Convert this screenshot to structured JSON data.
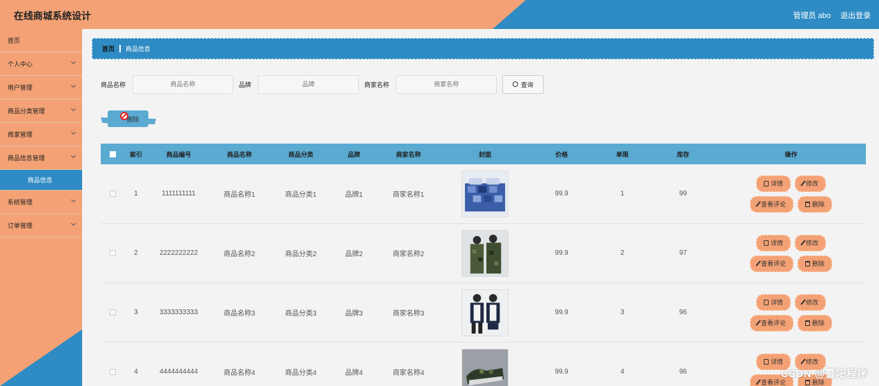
{
  "header": {
    "title": "在线商城系统设计",
    "user": "管理员 abo",
    "logout": "退出登录"
  },
  "sidebar": {
    "items": [
      {
        "label": "首页",
        "chevron": false
      },
      {
        "label": "个人中心",
        "chevron": true
      },
      {
        "label": "用户管理",
        "chevron": true
      },
      {
        "label": "商品分类管理",
        "chevron": true
      },
      {
        "label": "商家管理",
        "chevron": true
      },
      {
        "label": "商品信息管理",
        "chevron": true
      }
    ],
    "active_sub": "商品信息",
    "items_after": [
      {
        "label": "系统管理",
        "chevron": true
      },
      {
        "label": "订单管理",
        "chevron": true
      }
    ]
  },
  "breadcrumb": {
    "home": "首页",
    "current": "商品信息"
  },
  "search": {
    "name_label": "商品名称",
    "name_placeholder": "商品名称",
    "brand_label": "品牌",
    "brand_placeholder": "品牌",
    "shop_label": "商家名称",
    "shop_placeholder": "商家名称",
    "query": "查询"
  },
  "batch_delete": "删除",
  "table": {
    "headers": [
      "索引",
      "商品编号",
      "商品名称",
      "商品分类",
      "品牌",
      "商家名称",
      "封面",
      "价格",
      "单限",
      "库存",
      "操作"
    ],
    "rows": [
      {
        "index": "1",
        "code": "1111111111",
        "name": "商品名称1",
        "category": "商品分类1",
        "brand": "品牌1",
        "shop": "商家名称1",
        "price": "99.9",
        "limit": "1",
        "stock": "99"
      },
      {
        "index": "2",
        "code": "2222222222",
        "name": "商品名称2",
        "category": "商品分类2",
        "brand": "品牌2",
        "shop": "商家名称2",
        "price": "99.9",
        "limit": "2",
        "stock": "97"
      },
      {
        "index": "3",
        "code": "3333333333",
        "name": "商品名称3",
        "category": "商品分类3",
        "brand": "品牌3",
        "shop": "商家名称3",
        "price": "99.9",
        "limit": "3",
        "stock": "96"
      },
      {
        "index": "4",
        "code": "4444444444",
        "name": "商品名称4",
        "category": "商品分类4",
        "brand": "品牌4",
        "shop": "商家名称4",
        "price": "99.9",
        "limit": "4",
        "stock": "96"
      }
    ],
    "ops": {
      "detail": "详情",
      "edit": "修改",
      "comments": "查看评论",
      "delete": "删除"
    }
  },
  "watermark": "CSDN @暨阳程序",
  "colors": {
    "orange": "#f4a275",
    "blue": "#2e8bc3",
    "table_header": "#5aaad2"
  }
}
